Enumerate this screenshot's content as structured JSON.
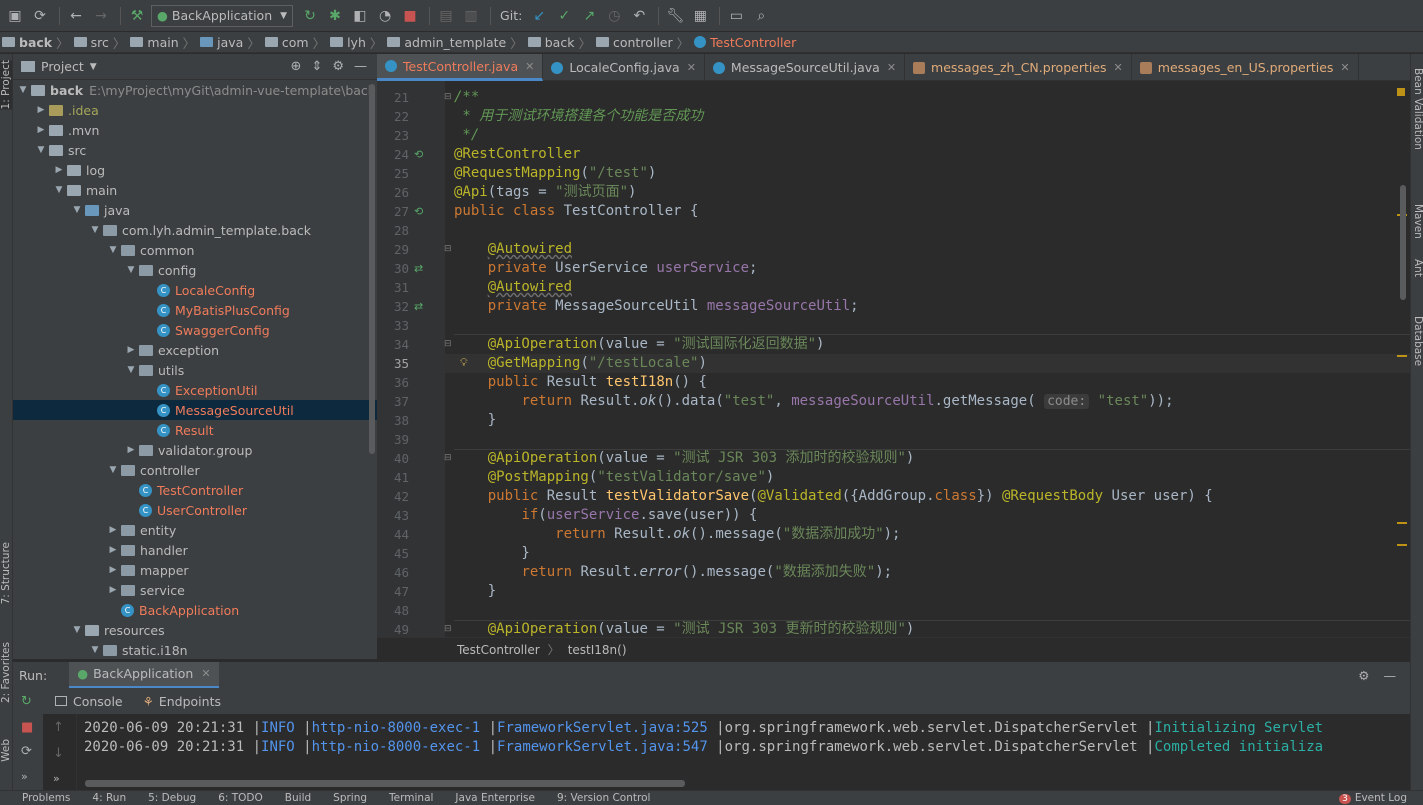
{
  "toolbar": {
    "run_config": "BackApplication",
    "git_label": "Git:"
  },
  "breadcrumb": [
    "back",
    "src",
    "main",
    "java",
    "com",
    "lyh",
    "admin_template",
    "back",
    "controller",
    "TestController"
  ],
  "left_strip": {
    "project": "1: Project",
    "structure": "7: Structure",
    "favorites": "2: Favorites",
    "web": "Web"
  },
  "right_strip": {
    "bean_validation": "Bean Validation",
    "maven": "Maven",
    "ant": "Ant",
    "database": "Database"
  },
  "project_panel": {
    "title": "Project"
  },
  "tree": [
    {
      "label": "back",
      "path": "E:\\myProject\\myGit\\admin-vue-template\\back",
      "indent": 0,
      "arrow": "▼",
      "kind": "folder-bold"
    },
    {
      "label": ".idea",
      "indent": 1,
      "arrow": "▶",
      "kind": "folder-olive"
    },
    {
      "label": ".mvn",
      "indent": 1,
      "arrow": "▶",
      "kind": "folder"
    },
    {
      "label": "src",
      "indent": 1,
      "arrow": "▼",
      "kind": "folder"
    },
    {
      "label": "log",
      "indent": 2,
      "arrow": "▶",
      "kind": "folder"
    },
    {
      "label": "main",
      "indent": 2,
      "arrow": "▼",
      "kind": "folder"
    },
    {
      "label": "java",
      "indent": 3,
      "arrow": "▼",
      "kind": "folder-src"
    },
    {
      "label": "com.lyh.admin_template.back",
      "indent": 4,
      "arrow": "▼",
      "kind": "package"
    },
    {
      "label": "common",
      "indent": 5,
      "arrow": "▼",
      "kind": "package"
    },
    {
      "label": "config",
      "indent": 6,
      "arrow": "▼",
      "kind": "package"
    },
    {
      "label": "LocaleConfig",
      "indent": 7,
      "arrow": "",
      "kind": "class"
    },
    {
      "label": "MyBatisPlusConfig",
      "indent": 7,
      "arrow": "",
      "kind": "class"
    },
    {
      "label": "SwaggerConfig",
      "indent": 7,
      "arrow": "",
      "kind": "class"
    },
    {
      "label": "exception",
      "indent": 6,
      "arrow": "▶",
      "kind": "package"
    },
    {
      "label": "utils",
      "indent": 6,
      "arrow": "▼",
      "kind": "package"
    },
    {
      "label": "ExceptionUtil",
      "indent": 7,
      "arrow": "",
      "kind": "class"
    },
    {
      "label": "MessageSourceUtil",
      "indent": 7,
      "arrow": "",
      "kind": "class",
      "selected": true
    },
    {
      "label": "Result",
      "indent": 7,
      "arrow": "",
      "kind": "class"
    },
    {
      "label": "validator.group",
      "indent": 6,
      "arrow": "▶",
      "kind": "package"
    },
    {
      "label": "controller",
      "indent": 5,
      "arrow": "▼",
      "kind": "package"
    },
    {
      "label": "TestController",
      "indent": 6,
      "arrow": "",
      "kind": "class"
    },
    {
      "label": "UserController",
      "indent": 6,
      "arrow": "",
      "kind": "class"
    },
    {
      "label": "entity",
      "indent": 5,
      "arrow": "▶",
      "kind": "package"
    },
    {
      "label": "handler",
      "indent": 5,
      "arrow": "▶",
      "kind": "package"
    },
    {
      "label": "mapper",
      "indent": 5,
      "arrow": "▶",
      "kind": "package"
    },
    {
      "label": "service",
      "indent": 5,
      "arrow": "▶",
      "kind": "package"
    },
    {
      "label": "BackApplication",
      "indent": 5,
      "arrow": "",
      "kind": "class-app"
    },
    {
      "label": "resources",
      "indent": 3,
      "arrow": "▼",
      "kind": "folder-res"
    },
    {
      "label": "static.i18n",
      "indent": 4,
      "arrow": "▼",
      "kind": "package"
    }
  ],
  "tabs": [
    {
      "label": "TestController.java",
      "active": true,
      "type": "class"
    },
    {
      "label": "LocaleConfig.java",
      "active": false,
      "type": "class"
    },
    {
      "label": "MessageSourceUtil.java",
      "active": false,
      "type": "class"
    },
    {
      "label": "messages_zh_CN.properties",
      "active": false,
      "type": "prop"
    },
    {
      "label": "messages_en_US.properties",
      "active": false,
      "type": "prop"
    }
  ],
  "editor": {
    "current_line": 35,
    "lines": [
      {
        "n": 21,
        "html": "<span class='cm'>/**</span>"
      },
      {
        "n": 22,
        "html": "<span class='cm'> * 用于测试环境搭建各个功能是否成功</span>"
      },
      {
        "n": 23,
        "html": "<span class='cm'> */</span>"
      },
      {
        "n": 24,
        "html": "<span class='a'>@RestController</span>"
      },
      {
        "n": 25,
        "html": "<span class='a'>@RequestMapping</span>(<span class='s'>\"/test\"</span>)"
      },
      {
        "n": 26,
        "html": "<span class='a'>@Api</span>(tags = <span class='s'>\"测试页面\"</span>)"
      },
      {
        "n": 27,
        "html": "<span class='k'>public class </span>TestController {"
      },
      {
        "n": 28,
        "html": ""
      },
      {
        "n": 29,
        "html": "    <span class='a und'>@Autowired</span>"
      },
      {
        "n": 30,
        "html": "    <span class='k'>private </span>UserService <span class='f'>userService</span>;"
      },
      {
        "n": 31,
        "html": "    <span class='a und'>@Autowired</span>"
      },
      {
        "n": 32,
        "html": "    <span class='k'>private </span>MessageSourceUtil <span class='f'>messageSourceUtil</span>;"
      },
      {
        "n": 33,
        "html": ""
      },
      {
        "n": 34,
        "html": "    <span class='a'>@ApiOperation</span>(value = <span class='s'>\"测试国际化返回数据\"</span>)"
      },
      {
        "n": 35,
        "html": "    <span class='a'>@GetMapping</span>(<span class='s'>\"/testLocale\"</span>)"
      },
      {
        "n": 36,
        "html": "    <span class='k'>public </span>Result <span class='m'>testI18n</span>() {"
      },
      {
        "n": 37,
        "html": "        <span class='k'>return </span>Result.<span class='i'>ok</span>().data(<span class='s'>\"test\"</span>, <span class='f'>messageSourceUtil</span>.getMessage( <span class='hint'>code:</span> <span class='s'>\"test\"</span>));"
      },
      {
        "n": 38,
        "html": "    }"
      },
      {
        "n": 39,
        "html": ""
      },
      {
        "n": 40,
        "html": "    <span class='a'>@ApiOperation</span>(value = <span class='s'>\"测试 JSR 303 添加时的校验规则\"</span>)"
      },
      {
        "n": 41,
        "html": "    <span class='a'>@PostMapping</span>(<span class='s'>\"testValidator/save\"</span>)"
      },
      {
        "n": 42,
        "html": "    <span class='k'>public </span>Result <span class='m'>testValidatorSave</span>(<span class='a'>@Validated</span>({AddGroup.<span class='k'>class</span>}) <span class='a'>@RequestBody </span>User user) {"
      },
      {
        "n": 43,
        "html": "        <span class='k'>if</span>(<span class='f'>userService</span>.save(user)) {"
      },
      {
        "n": 44,
        "html": "            <span class='k'>return </span>Result.<span class='i'>ok</span>().message(<span class='s'>\"数据添加成功\"</span>);"
      },
      {
        "n": 45,
        "html": "        }"
      },
      {
        "n": 46,
        "html": "        <span class='k'>return </span>Result.<span class='i'>error</span>().message(<span class='s'>\"数据添加失败\"</span>);"
      },
      {
        "n": 47,
        "html": "    }"
      },
      {
        "n": 48,
        "html": ""
      },
      {
        "n": 49,
        "html": "    <span class='a'>@ApiOperation</span>(value = <span class='s'>\"测试 JSR 303 更新时的校验规则\"</span>)"
      }
    ]
  },
  "editor_breadcrumb": {
    "class": "TestController",
    "method": "testI18n()"
  },
  "run_panel": {
    "label": "Run:",
    "config": "BackApplication",
    "console_tab": "Console",
    "endpoints_tab": "Endpoints"
  },
  "console": [
    {
      "ts": "2020-06-09 20:21:31",
      "level": "INFO",
      "thread": "http-nio-8000-exec-1",
      "file": "FrameworkServlet.java:525",
      "cls": "org.springframework.web.servlet.DispatcherServlet",
      "msg": "Initializing Servlet"
    },
    {
      "ts": "2020-06-09 20:21:31",
      "level": "INFO",
      "thread": "http-nio-8000-exec-1",
      "file": "FrameworkServlet.java:547",
      "cls": "org.springframework.web.servlet.DispatcherServlet",
      "msg": "Completed initializa"
    }
  ],
  "statusbar": [
    "Problems",
    "4: Run",
    "5: Debug",
    "6: TODO",
    "Build",
    "Spring",
    "Terminal",
    "Java Enterprise",
    "9: Version Control"
  ],
  "event_log": "Event Log",
  "event_count": "3"
}
